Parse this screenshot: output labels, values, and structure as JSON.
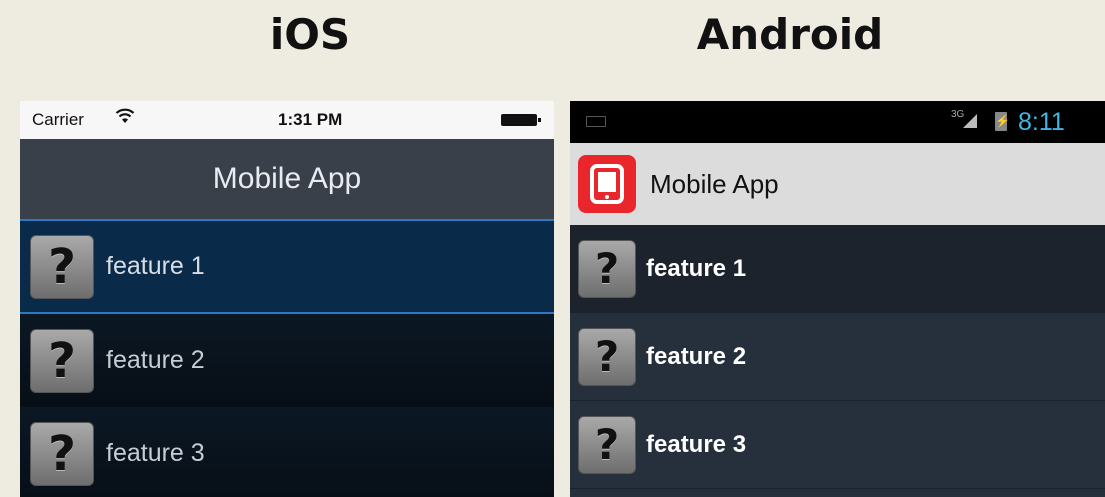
{
  "headings": {
    "ios": "iOS",
    "android": "Android"
  },
  "ios": {
    "status_bar": {
      "carrier": "Carrier",
      "wifi_icon": "wifi-icon",
      "time": "1:31 PM",
      "battery_icon": "battery-icon"
    },
    "nav_title": "Mobile App",
    "items": [
      {
        "label": "feature 1",
        "icon": "question-icon",
        "selected": true
      },
      {
        "label": "feature 2",
        "icon": "question-icon",
        "selected": false
      },
      {
        "label": "feature 3",
        "icon": "question-icon",
        "selected": false
      }
    ],
    "colors": {
      "navbar": "#3a4049",
      "selection": "#0a2a4a",
      "accent": "#2f78c4"
    }
  },
  "android": {
    "status_bar": {
      "network": "3G",
      "time": "8:11",
      "keyboard_icon": "keyboard-icon",
      "signal_icon": "signal-icon",
      "battery_icon": "battery-charging-icon"
    },
    "app_icon": "mobile-app-icon",
    "action_bar_title": "Mobile App",
    "items": [
      {
        "label": "feature 1",
        "icon": "question-icon"
      },
      {
        "label": "feature 2",
        "icon": "question-icon"
      },
      {
        "label": "feature 3",
        "icon": "question-icon"
      }
    ],
    "colors": {
      "action_bar": "#dcdcdc",
      "app_icon": "#e8262b",
      "list_bg": "#262f3c",
      "status_text": "#3fb6e5"
    }
  }
}
